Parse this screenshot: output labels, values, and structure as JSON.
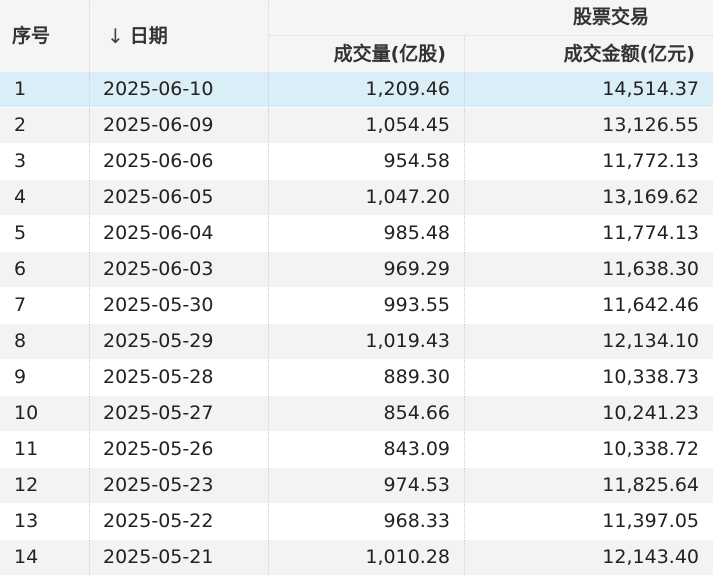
{
  "table": {
    "headers": {
      "index": "序号",
      "date_arrow": "↓",
      "date": "日期",
      "group": "股票交易",
      "volume": "成交量(亿股)",
      "turnover": "成交金额(亿元)"
    },
    "rows": [
      {
        "index": "1",
        "date": "2025-06-10",
        "volume": "1,209.46",
        "turnover": "14,514.37"
      },
      {
        "index": "2",
        "date": "2025-06-09",
        "volume": "1,054.45",
        "turnover": "13,126.55"
      },
      {
        "index": "3",
        "date": "2025-06-06",
        "volume": "954.58",
        "turnover": "11,772.13"
      },
      {
        "index": "4",
        "date": "2025-06-05",
        "volume": "1,047.20",
        "turnover": "13,169.62"
      },
      {
        "index": "5",
        "date": "2025-06-04",
        "volume": "985.48",
        "turnover": "11,774.13"
      },
      {
        "index": "6",
        "date": "2025-06-03",
        "volume": "969.29",
        "turnover": "11,638.30"
      },
      {
        "index": "7",
        "date": "2025-05-30",
        "volume": "993.55",
        "turnover": "11,642.46"
      },
      {
        "index": "8",
        "date": "2025-05-29",
        "volume": "1,019.43",
        "turnover": "12,134.10"
      },
      {
        "index": "9",
        "date": "2025-05-28",
        "volume": "889.30",
        "turnover": "10,338.73"
      },
      {
        "index": "10",
        "date": "2025-05-27",
        "volume": "854.66",
        "turnover": "10,241.23"
      },
      {
        "index": "11",
        "date": "2025-05-26",
        "volume": "843.09",
        "turnover": "10,338.72"
      },
      {
        "index": "12",
        "date": "2025-05-23",
        "volume": "974.53",
        "turnover": "11,825.64"
      },
      {
        "index": "13",
        "date": "2025-05-22",
        "volume": "968.33",
        "turnover": "11,397.05"
      },
      {
        "index": "14",
        "date": "2025-05-21",
        "volume": "1,010.28",
        "turnover": "12,143.40"
      }
    ]
  },
  "colors": {
    "header_bg": "#f5f5f5",
    "selected_row_bg": "#d9eef6",
    "alt_row_bg": "#f2f3f3"
  }
}
